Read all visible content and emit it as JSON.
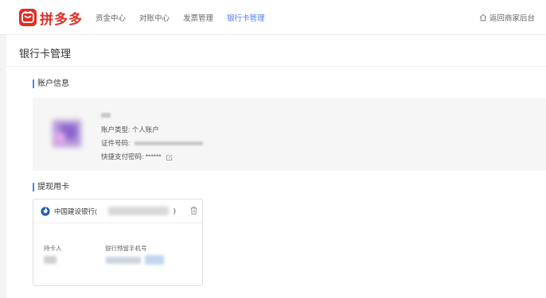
{
  "header": {
    "logo_text": "拼多多",
    "nav": [
      {
        "label": "资金中心",
        "active": false
      },
      {
        "label": "对账中心",
        "active": false
      },
      {
        "label": "发票管理",
        "active": false
      },
      {
        "label": "银行卡管理",
        "active": true
      }
    ],
    "back_label": "返回商家后台"
  },
  "page": {
    "title": "银行卡管理"
  },
  "account": {
    "section_title": "账户信息",
    "type_label": "账户类型:",
    "type_value": "个人账户",
    "id_label": "证件号码:",
    "pay_pwd_label": "快捷支付密码:",
    "pay_pwd_value": "******"
  },
  "withdraw": {
    "section_title": "提现用卡",
    "card": {
      "bank_name": "中国建设银行(",
      "number_suffix": ")",
      "holder_label": "持卡人",
      "phone_label": "银行预留手机号"
    }
  },
  "colors": {
    "brand_red": "#e02e24",
    "accent_blue": "#4a7ef0",
    "bank_blue": "#1f5fb8"
  },
  "icons": {
    "home": "home-icon",
    "edit": "edit-icon",
    "bank": "ccb-logo-icon",
    "delete": "trash-icon"
  }
}
